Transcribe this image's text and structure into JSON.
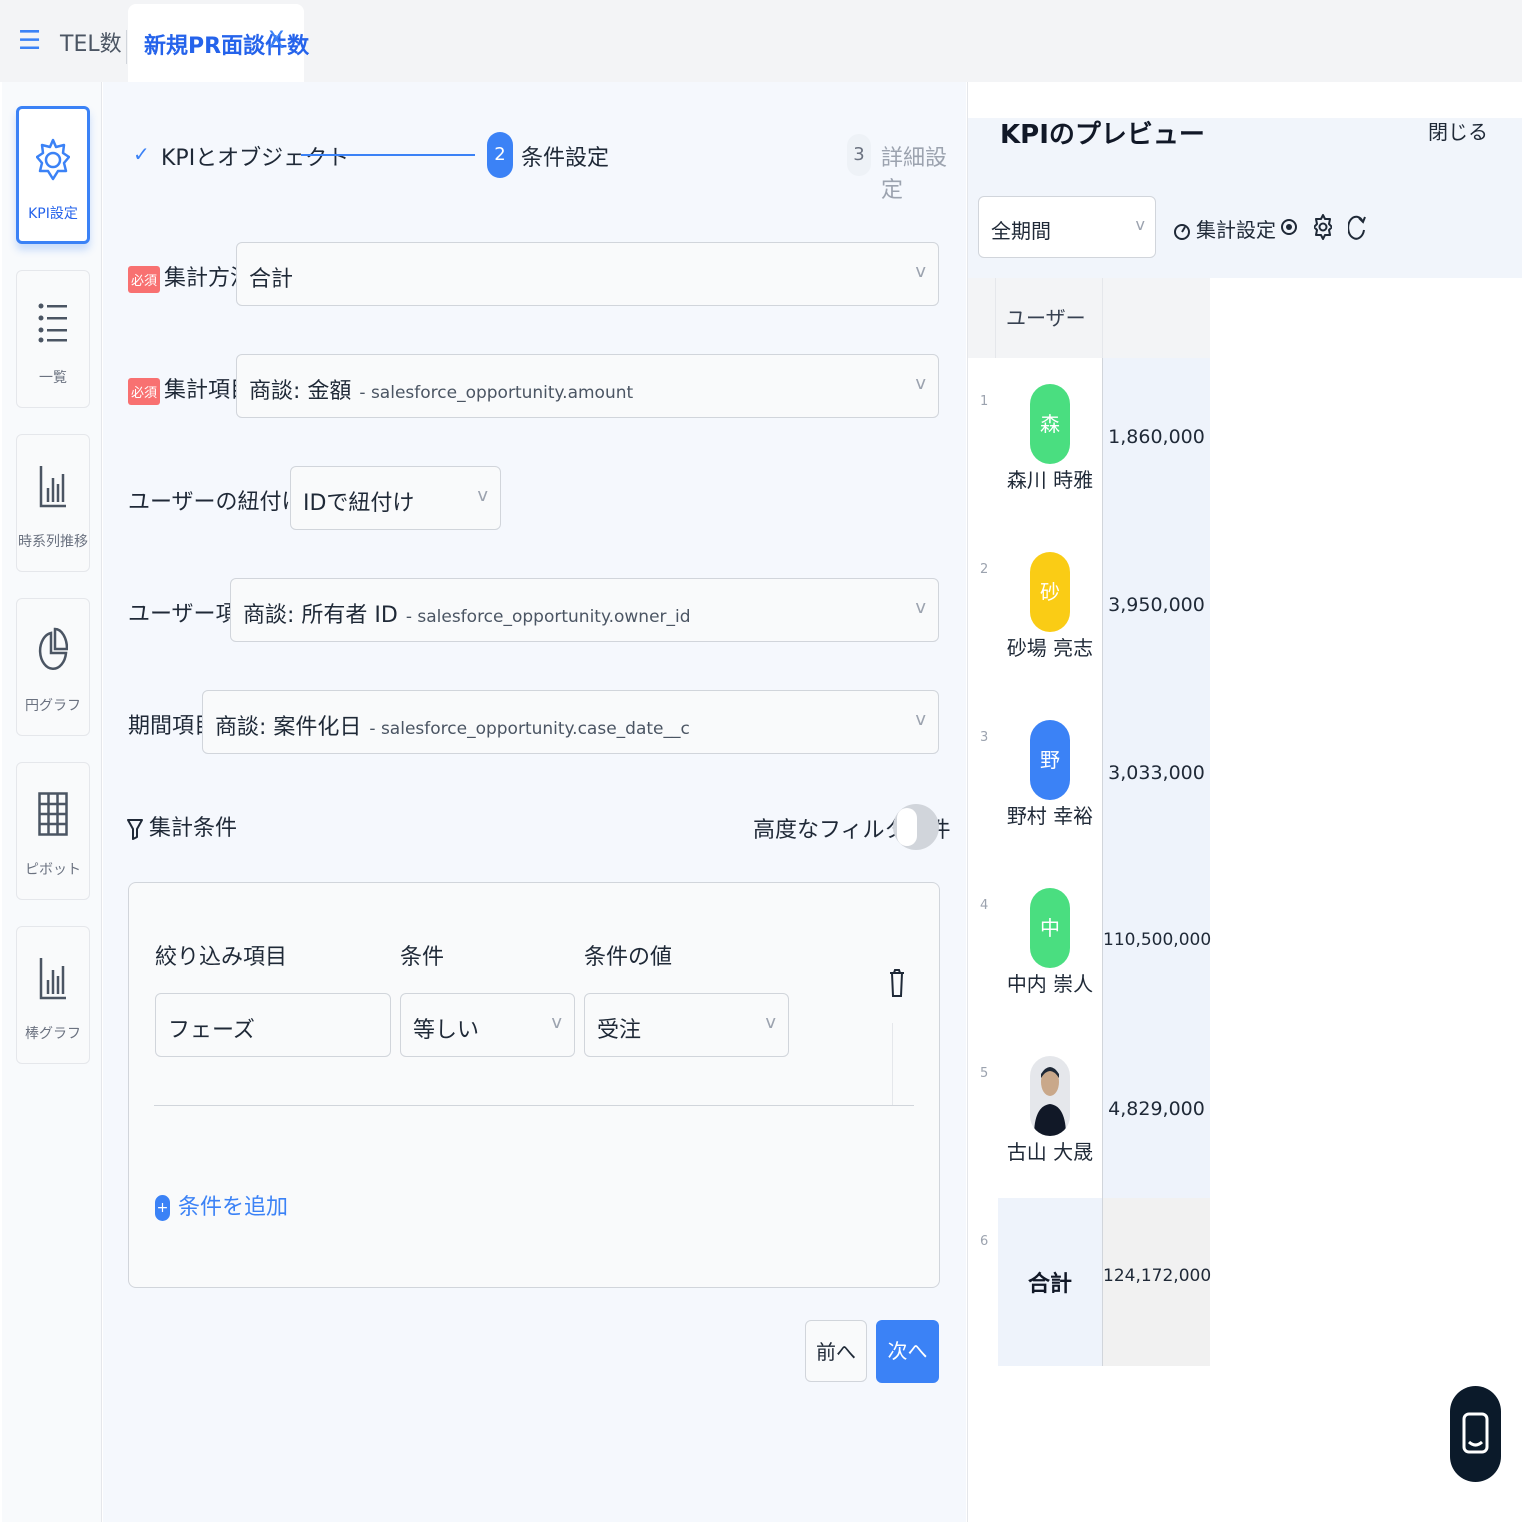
{
  "tabs": {
    "tel": "TEL数",
    "active": "新規PR面談件数",
    "close": "X"
  },
  "rail": [
    {
      "label": "KPI設定",
      "icon": "gear-icon",
      "active": true
    },
    {
      "label": "一覧",
      "icon": "list-icon"
    },
    {
      "label": "時系列推移",
      "icon": "bar-chart-icon"
    },
    {
      "label": "円グラフ",
      "icon": "pie-chart-icon"
    },
    {
      "label": "ピボット",
      "icon": "grid-icon"
    },
    {
      "label": "棒グラフ",
      "icon": "bar-chart-icon"
    }
  ],
  "steps": {
    "step1": "KPIとオブジェクト",
    "step2_num": "2",
    "step2": "条件設定",
    "step3_num": "3",
    "step3": "詳細設定"
  },
  "form": {
    "required": "必須",
    "agg_method_label": "集計方法:",
    "agg_method_value": "合計",
    "agg_item_label": "集計項目:",
    "agg_item_value": "商談: 金額",
    "agg_item_sub": "- salesforce_opportunity.amount",
    "user_link_label": "ユーザーの紐付け方法:",
    "user_link_value": "IDで紐付け",
    "user_item_label": "ユーザー項目:",
    "user_item_value": "商談: 所有者 ID",
    "user_item_sub": "- salesforce_opportunity.owner_id",
    "period_item_label": "期間項目:",
    "period_item_value": "商談: 案件化日",
    "period_item_sub": "- salesforce_opportunity.case_date__c",
    "chevron": "v"
  },
  "filters": {
    "title": "集計条件",
    "advanced_label": "高度なフィルタ条件",
    "col_field": "絞り込み項目",
    "col_cond": "条件",
    "col_value": "条件の値",
    "field_value": "フェーズ",
    "cond_value": "等しい",
    "value_value": "受注",
    "add_condition": "条件を追加"
  },
  "buttons": {
    "prev": "前へ",
    "next": "次へ"
  },
  "preview": {
    "title": "KPIのプレビュー",
    "close": "閉じる",
    "period": "全期間",
    "agg_settings": "集計設定",
    "user_header": "ユーザー",
    "rows": [
      {
        "num": "1",
        "initial": "森",
        "name": "森川 時雅",
        "value": "1,860,000",
        "color": "#4ade80"
      },
      {
        "num": "2",
        "initial": "砂",
        "name": "砂場 亮志",
        "value": "3,950,000",
        "color": "#facc15"
      },
      {
        "num": "3",
        "initial": "野",
        "name": "野村 幸裕",
        "value": "3,033,000",
        "color": "#3b82f6"
      },
      {
        "num": "4",
        "initial": "中",
        "name": "中内 崇人",
        "value": "110,500,000",
        "color": "#4ade80"
      },
      {
        "num": "5",
        "initial": "",
        "name": "古山 大晟",
        "value": "4,829,000",
        "color": "#374151"
      }
    ],
    "total": {
      "num": "6",
      "label": "合計",
      "value": "124,172,000"
    }
  }
}
